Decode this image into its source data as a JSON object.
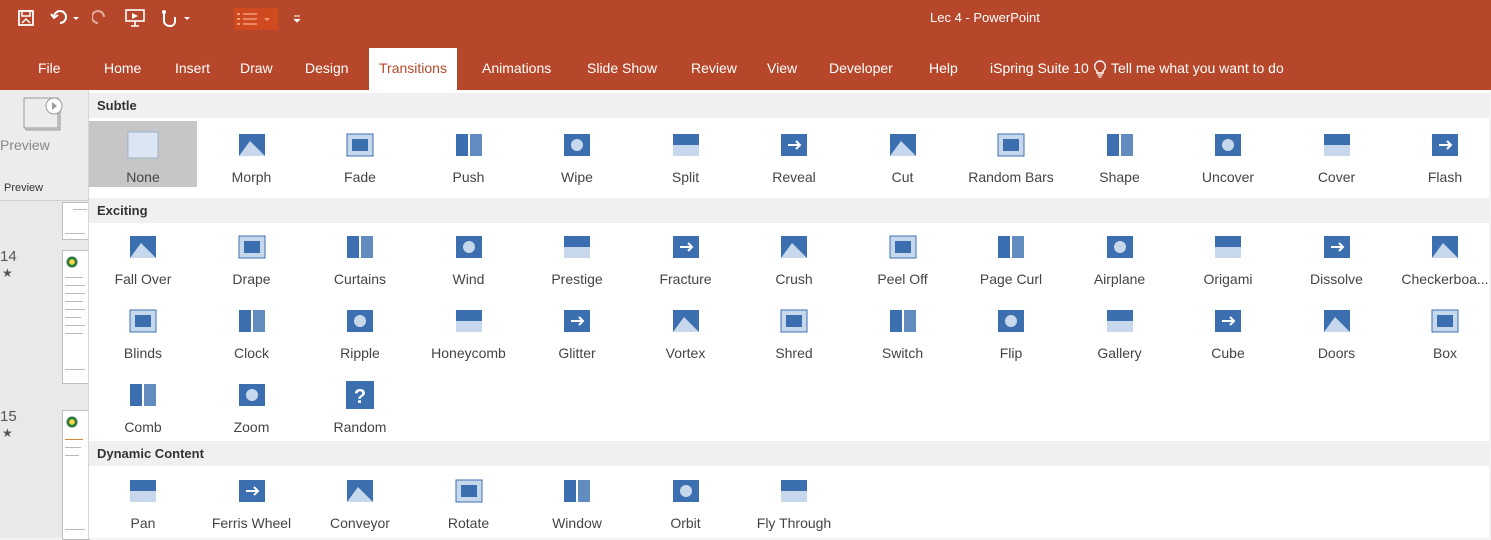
{
  "window": {
    "title": "Lec 4  -  PowerPoint"
  },
  "qat": {
    "save_icon": "save-icon",
    "undo_icon": "undo-icon",
    "redo_icon": "redo-icon",
    "presenter_icon": "from-beginning-icon",
    "touch_icon": "touch-mode-icon",
    "bullets_icon": "bullets-icon",
    "customize_icon": "customize-qat-icon"
  },
  "tabs": [
    "File",
    "Home",
    "Insert",
    "Draw",
    "Design",
    "Transitions",
    "Animations",
    "Slide Show",
    "Review",
    "View",
    "Developer",
    "Help",
    "iSpring Suite 10"
  ],
  "active_tab": "Transitions",
  "tell_me": "Tell me what you want to do",
  "preview": {
    "button_label": "Preview",
    "group_label": "Preview"
  },
  "slides": [
    {
      "number": "14",
      "star": "★"
    },
    {
      "number": "15",
      "star": "★"
    }
  ],
  "gallery": {
    "groups": [
      {
        "title": "Subtle",
        "items": [
          "None",
          "Morph",
          "Fade",
          "Push",
          "Wipe",
          "Split",
          "Reveal",
          "Cut",
          "Random Bars",
          "Shape",
          "Uncover",
          "Cover",
          "Flash"
        ]
      },
      {
        "title": "Exciting",
        "items": [
          "Fall Over",
          "Drape",
          "Curtains",
          "Wind",
          "Prestige",
          "Fracture",
          "Crush",
          "Peel Off",
          "Page Curl",
          "Airplane",
          "Origami",
          "Dissolve",
          "Checkerboa...",
          "Blinds",
          "Clock",
          "Ripple",
          "Honeycomb",
          "Glitter",
          "Vortex",
          "Shred",
          "Switch",
          "Flip",
          "Gallery",
          "Cube",
          "Doors",
          "Box",
          "Comb",
          "Zoom",
          "Random"
        ]
      },
      {
        "title": "Dynamic Content",
        "items": [
          "Pan",
          "Ferris Wheel",
          "Conveyor",
          "Rotate",
          "Window",
          "Orbit",
          "Fly Through"
        ]
      }
    ],
    "selected": "None"
  },
  "colors": {
    "accent": "#b7472a",
    "icon_blue": "#3b6fb0",
    "icon_light": "#c8d8ec"
  }
}
